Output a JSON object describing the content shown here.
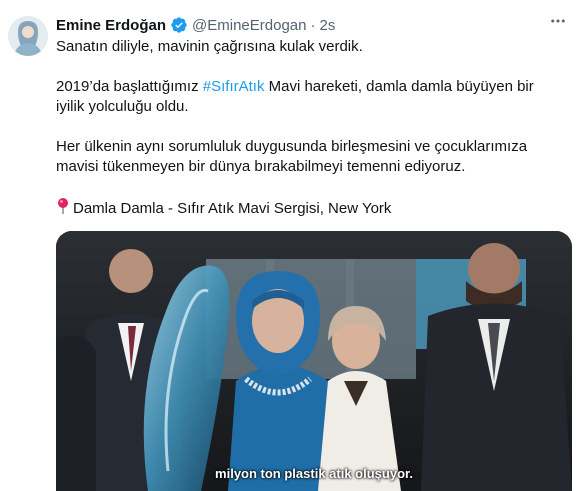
{
  "author": {
    "display_name": "Emine Erdoğan",
    "handle": "@EmineErdogan",
    "separator": "·",
    "time": "2s",
    "verified": true
  },
  "tweet": {
    "line1": "Sanatın diliyle, mavinin çağrısına kulak verdik.",
    "line2_prefix": "2019’da başlattığımız ",
    "line2_hashtag": "#SıfırAtık",
    "line2_suffix_a": " Mavi hareketi, damla damla büyüyen bir",
    "line2_suffix_b": "iyilik yolculuğu oldu.",
    "line3_a": "Her ülkenin aynı sorumluluk duygusunda birleşmesini ve çocuklarımıza",
    "line3_b": "mavisi tükenmeyen bir dünya bırakabilmeyi temenni ediyoruz.",
    "line4": "Damla Damla - Sıfır Atık Mavi Sergisi, New York",
    "line4_icon": "round-pushpin-icon"
  },
  "media": {
    "caption": "milyon ton plastik atık oluşuyor."
  },
  "colors": {
    "link": "#1d9bf0",
    "verified": "#1d9bf0",
    "secondary_text": "#536471",
    "primary_text": "#0f1419"
  }
}
